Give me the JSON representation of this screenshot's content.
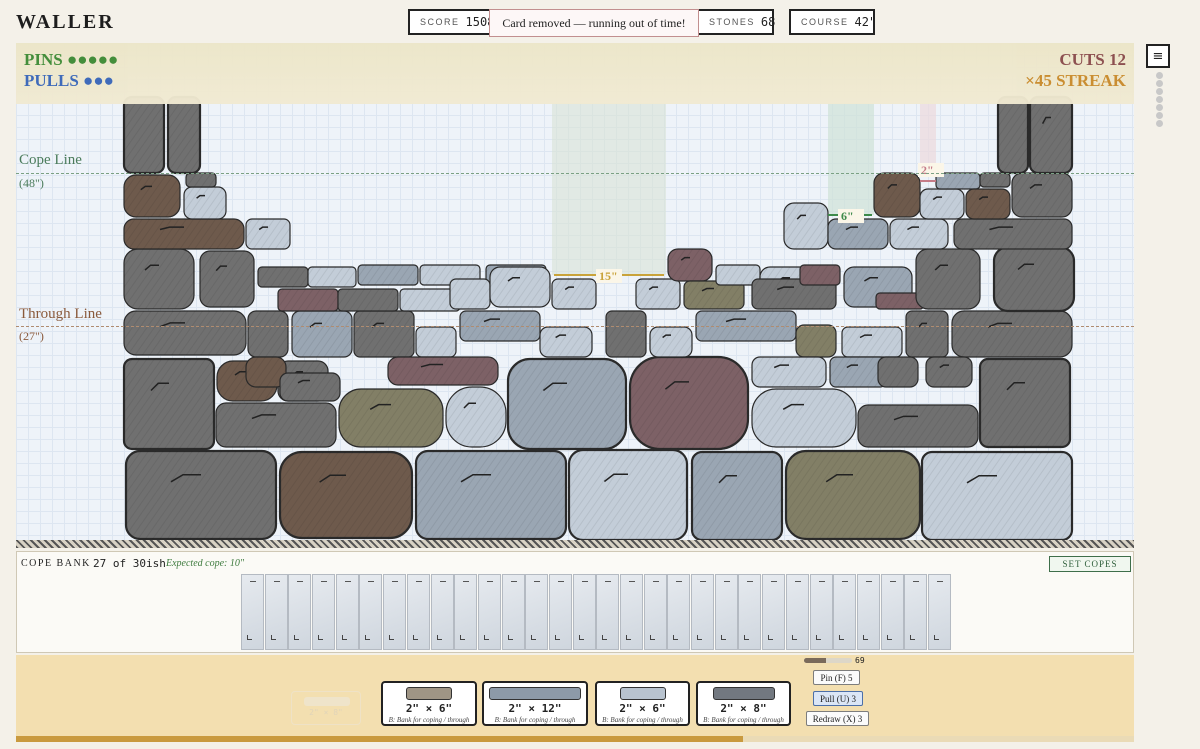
{
  "app": {
    "title": "WALLER"
  },
  "stats": {
    "score_label": "SCORE",
    "score_value": "15086",
    "stones_label": "STONES",
    "stones_value": "68",
    "course_label": "COURSE",
    "course_value": "42\""
  },
  "toast": "Card removed — running out of time!",
  "hud": {
    "pins_label": "PINS",
    "pins_dots": "●●●●●",
    "pulls_label": "PULLS",
    "pulls_dots": "●●●",
    "cuts": "CUTS 12",
    "streak": "×45 STREAK"
  },
  "board": {
    "cope_line_label": "Cope Line",
    "cope_line_height": "(48\")",
    "through_line_label": "Through Line",
    "through_line_height": "(27\")",
    "gap_labels": [
      "15\"",
      "6\"",
      "2\""
    ]
  },
  "colors": {
    "cope_line": "#4b7c5c",
    "through_line": "#8a5a3c",
    "pins": "#3e8a34",
    "pulls": "#3866b8",
    "cuts": "#8a4a4a",
    "streak": "#c98a2a",
    "stone_palette": [
      "#707070",
      "#9aa6b3",
      "#c3cdd8",
      "#6e5a4c",
      "#7d6166",
      "#827f66",
      "#b9c4cf"
    ]
  },
  "menu": {
    "icon": "hamburger-icon",
    "glyph": "≡"
  },
  "bank": {
    "title": "COPE BANK",
    "count": "27 of 30ish",
    "expected": "Expected cope: 10\"",
    "set_copes": "SET COPES",
    "cards_shown": 30
  },
  "hand": {
    "ghost_size": "2\" × 8\"",
    "cards": [
      {
        "size": "2\" × 6\"",
        "hint": "B: Bank for coping / through",
        "color": "#9f9585"
      },
      {
        "size": "2\" × 12\"",
        "hint": "B: Bank for coping / through",
        "color": "#8d9aa8"
      },
      {
        "size": "2\" × 6\"",
        "hint": "B: Bank for coping / through",
        "color": "#b8c3cf"
      },
      {
        "size": "2\" × 8\"",
        "hint": "B: Bank for coping / through",
        "color": "#727880"
      }
    ]
  },
  "actions": {
    "meter_value": "69",
    "meter_fraction": 0.45,
    "pin": "Pin (F) 5",
    "pull": "Pull (U) 3",
    "redraw": "Redraw (X) 3"
  },
  "progress_fraction": 0.65
}
